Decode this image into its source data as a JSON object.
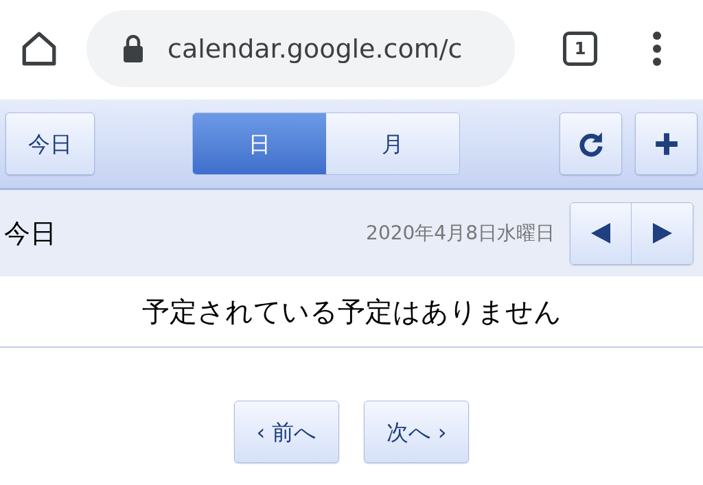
{
  "browser": {
    "url": "calendar.google.com/c",
    "tab_count": "1"
  },
  "toolbar": {
    "today": "今日",
    "views": [
      {
        "label": "日",
        "selected": true
      },
      {
        "label": "月",
        "selected": false
      }
    ]
  },
  "header": {
    "title": "今日",
    "date": "2020年4月8日水曜日"
  },
  "message": "予定されている予定はありません",
  "pager": {
    "prev": "‹ 前へ",
    "next": "次へ ›"
  }
}
